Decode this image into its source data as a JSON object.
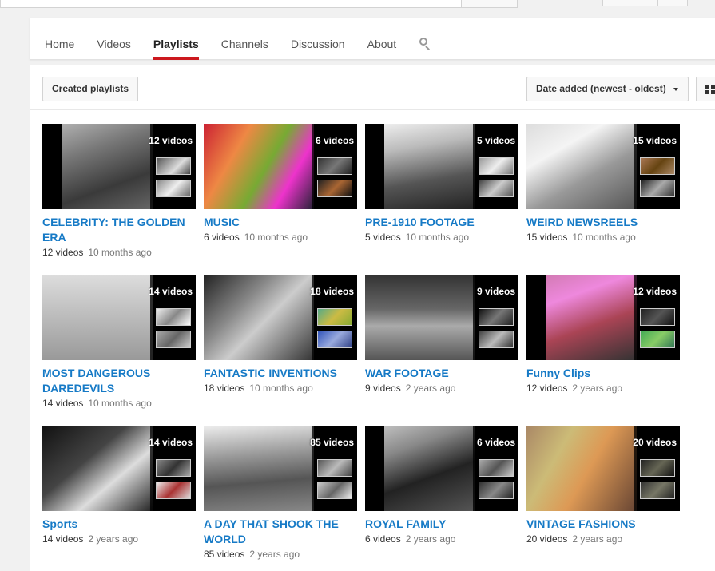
{
  "nav": {
    "tabs": [
      {
        "label": "Home"
      },
      {
        "label": "Videos"
      },
      {
        "label": "Playlists"
      },
      {
        "label": "Channels"
      },
      {
        "label": "Discussion"
      },
      {
        "label": "About"
      }
    ],
    "active_tab": "Playlists",
    "search_icon": "search-icon"
  },
  "toolbar": {
    "created_label": "Created playlists",
    "sort_label": "Date added (newest - oldest)",
    "grid_icon": "grid-view-icon"
  },
  "colors": {
    "link": "#167ac6",
    "active_tab_underline": "#cc181e",
    "background": "#f1f1f1"
  },
  "playlists": [
    {
      "title": "CELEBRITY: THE GOLDEN ERA",
      "count_badge": "12 videos",
      "count": "12 videos",
      "age": "10 months ago"
    },
    {
      "title": "MUSIC",
      "count_badge": "6 videos",
      "count": "6 videos",
      "age": "10 months ago"
    },
    {
      "title": "PRE-1910 FOOTAGE",
      "count_badge": "5 videos",
      "count": "5 videos",
      "age": "10 months ago"
    },
    {
      "title": "WEIRD NEWSREELS",
      "count_badge": "15 videos",
      "count": "15 videos",
      "age": "10 months ago"
    },
    {
      "title": "MOST DANGEROUS DAREDEVILS",
      "count_badge": "14 videos",
      "count": "14 videos",
      "age": "10 months ago"
    },
    {
      "title": "FANTASTIC INVENTIONS",
      "count_badge": "18 videos",
      "count": "18 videos",
      "age": "10 months ago"
    },
    {
      "title": "WAR FOOTAGE",
      "count_badge": "9 videos",
      "count": "9 videos",
      "age": "2 years ago"
    },
    {
      "title": "Funny Clips",
      "count_badge": "12 videos",
      "count": "12 videos",
      "age": "2 years ago"
    },
    {
      "title": "Sports",
      "count_badge": "14 videos",
      "count": "14 videos",
      "age": "2 years ago"
    },
    {
      "title": "A DAY THAT SHOOK THE WORLD",
      "count_badge": "85 videos",
      "count": "85 videos",
      "age": "2 years ago"
    },
    {
      "title": "ROYAL FAMILY",
      "count_badge": "6 videos",
      "count": "6 videos",
      "age": "2 years ago"
    },
    {
      "title": "VINTAGE FASHIONS",
      "count_badge": "20 videos",
      "count": "20 videos",
      "age": "2 years ago"
    }
  ]
}
